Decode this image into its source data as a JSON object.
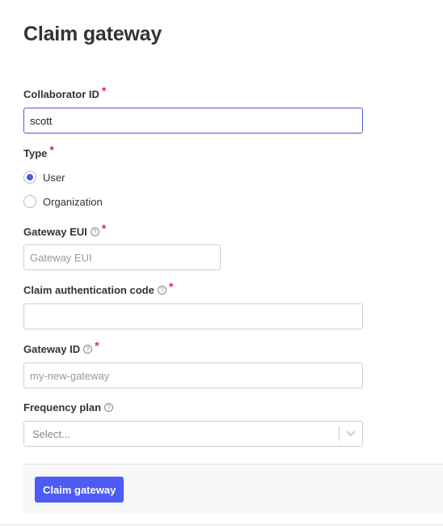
{
  "page": {
    "title": "Claim gateway"
  },
  "form": {
    "collaborator_id": {
      "label": "Collaborator ID",
      "required": "*",
      "value": "scott"
    },
    "type": {
      "label": "Type",
      "required": "*",
      "options": [
        {
          "label": "User",
          "selected": true
        },
        {
          "label": "Organization",
          "selected": false
        }
      ]
    },
    "gateway_eui": {
      "label": "Gateway EUI",
      "required": "*",
      "placeholder": "Gateway EUI",
      "value": ""
    },
    "claim_auth_code": {
      "label": "Claim authentication code",
      "required": "*",
      "placeholder": "",
      "value": ""
    },
    "gateway_id": {
      "label": "Gateway ID",
      "required": "*",
      "placeholder": "my-new-gateway",
      "value": ""
    },
    "frequency_plan": {
      "label": "Frequency plan",
      "placeholder": "Select..."
    },
    "help_glyph": "?"
  },
  "footer": {
    "submit_label": "Claim gateway"
  },
  "colors": {
    "accent": "#4c5cf5",
    "required": "#e0245e"
  }
}
